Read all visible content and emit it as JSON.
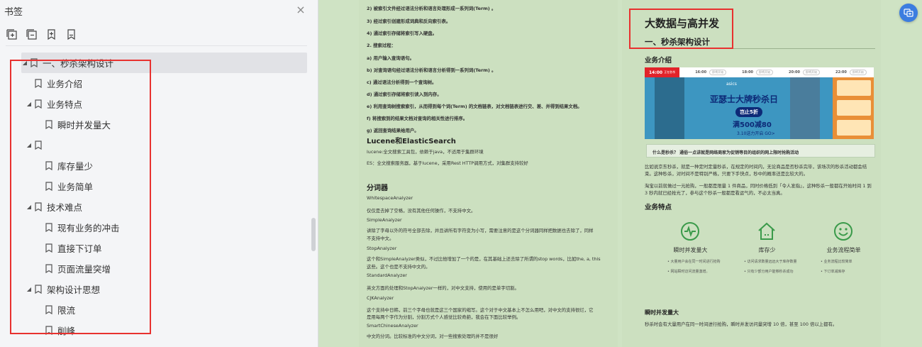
{
  "sidebar": {
    "title": "书签",
    "close_icon": "×",
    "toolbar": [
      {
        "name": "expand-all-icon"
      },
      {
        "name": "collapse-all-icon"
      },
      {
        "name": "add-bookmark-icon"
      },
      {
        "name": "bookmark-icon"
      }
    ],
    "tree": [
      {
        "label": "一、秒杀架构设计",
        "caret": "◢",
        "selected": true
      },
      {
        "label": "业务介绍",
        "caret": ""
      },
      {
        "label": "业务特点",
        "caret": "◢"
      },
      {
        "label": "瞬时并发量大",
        "caret": ""
      },
      {
        "label": "",
        "caret": "◢"
      },
      {
        "label": "库存量少",
        "caret": ""
      },
      {
        "label": "业务简单",
        "caret": ""
      },
      {
        "label": "技术难点",
        "caret": "◢"
      },
      {
        "label": "现有业务的冲击",
        "caret": ""
      },
      {
        "label": "直接下订单",
        "caret": ""
      },
      {
        "label": "页面流量突增",
        "caret": ""
      },
      {
        "label": "架构设计思想",
        "caret": "◢"
      },
      {
        "label": "限流",
        "caret": ""
      },
      {
        "label": "削峰",
        "caret": ""
      }
    ]
  },
  "page1": {
    "lines": [
      {
        "text": "2) 被索引文件经过语法分析和语言处理形成一系列词(Term) 。",
        "bold": true
      },
      {
        "text": "3) 经过索引创建形成词典和反向索引表。",
        "bold": true
      },
      {
        "text": "4) 通过索引存储将索引写入硬盘。",
        "bold": true
      },
      {
        "text": "2. 搜索过程：",
        "bold": true
      },
      {
        "text": "a) 用户输入查询语句。",
        "bold": true
      },
      {
        "text": "b) 对查询语句经过语法分析和语言分析得到一系列词(Term) 。",
        "bold": true
      },
      {
        "text": "c) 通过语法分析得到一个查询树。",
        "bold": true
      },
      {
        "text": "d) 通过索引存储将索引读入到内存。",
        "bold": true
      },
      {
        "text": "e) 利用查询树搜索索引，从而得到每个词(Term) 的文档链表，对文档链表进行交、差、并得到结果文档。",
        "bold": true
      },
      {
        "text": "f) 将搜索到的结果文档对查询的相关性进行排序。",
        "bold": true
      },
      {
        "text": "g) 返回查询结果给用户。",
        "bold": true
      }
    ],
    "heading1": "Lucene和ElasticSearch",
    "lines2": [
      "lucene:全文搜索工具包，依赖于java，不适用于集群环境",
      "ES：全文搜索服务器，基于lucene，采用Rest HTTP调用方式，对集群支持较好"
    ],
    "heading2": "分词器",
    "lines3": [
      {
        "text": "WhitespaceAnalyzer",
        "bold": false
      },
      {
        "text": "仅仅是去掉了空格，没有其他任何操作，不支持中文。",
        "bold": false
      },
      {
        "text": "SimpleAnalyzer",
        "bold": false
      },
      {
        "text": "讲除了字母以外的符号全部去除，并且讲所有字符变为小写，需要注意的是这个分词器同样把数据也去除了，同样",
        "bold": false
      },
      {
        "text": "不支持中文。",
        "bold": false
      },
      {
        "text": "StopAnalyzer",
        "bold": false
      },
      {
        "text": "这个和SimpleAnalyzer类似，不过比他增加了一个的是，在其基础上还去除了所谓的stop words，比如the, a, this",
        "bold": false
      },
      {
        "text": "这些。这个也是不支持中文的。",
        "bold": false
      },
      {
        "text": "StandardAnalyzer",
        "bold": false
      },
      {
        "text": "英文方面的处理和StopAnalyzer一样的，对中文支持，使用的是单字切割。",
        "bold": false
      },
      {
        "text": "CJKAnalyzer",
        "bold": false
      },
      {
        "text": "这个支持中日韩，前三个字母也就是这三个国家的缩写。这个对于中文基本上不怎么用吧，对中文的支持很烂，它",
        "bold": false
      },
      {
        "text": "是用每两个字作为分割，分割方式个人感觉比较奇葩，我会在下面比较举例。",
        "bold": false
      },
      {
        "text": "SmartChineseAnalyzer",
        "bold": false
      },
      {
        "text": "中文的分词。比较标准的中文分词，对一些搜索处理的并不是很好",
        "bold": false
      }
    ]
  },
  "page2": {
    "title": "大数据与高并发",
    "subtitle": "一、秒杀架构设计",
    "section1": "业务介绍",
    "banner": {
      "current_time": "14:00",
      "current_note": "正在秒杀",
      "times": [
        "16:00",
        "18:00",
        "20:00",
        "22:00"
      ],
      "times_note": "即将开始",
      "brand": "asics",
      "headline": "亚瑟士大牌秒杀日",
      "discount": "岂止5折",
      "offer": "满500减80",
      "date_note": "3.10送力开启 GO>"
    },
    "question": "什么是秒杀？ 通俗一点讲就是网络商家为促销等目的组织的网上限时抢购活动",
    "para1": [
      "比如说京东秒杀，就是一种定时定量秒杀，在规定的时间内，无论商品是否秒杀完毕，该场次的秒杀活动都会结",
      "束。这种秒杀，对时间不是特别严格，只要下手快点，秒中的概率还是比较大的。"
    ],
    "para2": [
      "淘宝以前就做过一元抢购，一般都是限量 1 件商品，同时价格低到「令人发指」，这种秒杀一般都在开始时间 1 到",
      "3 秒内就已经抢光了，参与这个秒杀一般都是看运气的，不必太当真。"
    ],
    "section2": "业务特点",
    "features": [
      {
        "title": "瞬时并发量大",
        "icon": "pulse-icon",
        "lines": [
          "大量用户会在同一时间进行抢购",
          "网站瞬时访问流量激增。"
        ]
      },
      {
        "title": "库存少",
        "icon": "house-icon",
        "lines": [
          "访问请求数量远远大于库存数量",
          "只有少部分用户能够秒杀成功"
        ]
      },
      {
        "title": "业务流程简单",
        "icon": "smile-icon",
        "lines": [
          "业务流程比较简单",
          "下订单减库存"
        ]
      }
    ],
    "section3": "瞬时并发量大",
    "para3": "秒杀时会有大量用户在同一时间进行抢购，瞬时并发访问量突增 10 倍，甚至 100 倍以上都有。"
  },
  "colors": {
    "doc_bg": "#cfe3c4",
    "accent_red": "#e8312f",
    "float_button": "#3c7de0",
    "feature_icon": "#3a9a4a"
  },
  "float_button": {
    "icon": "translate-icon"
  }
}
